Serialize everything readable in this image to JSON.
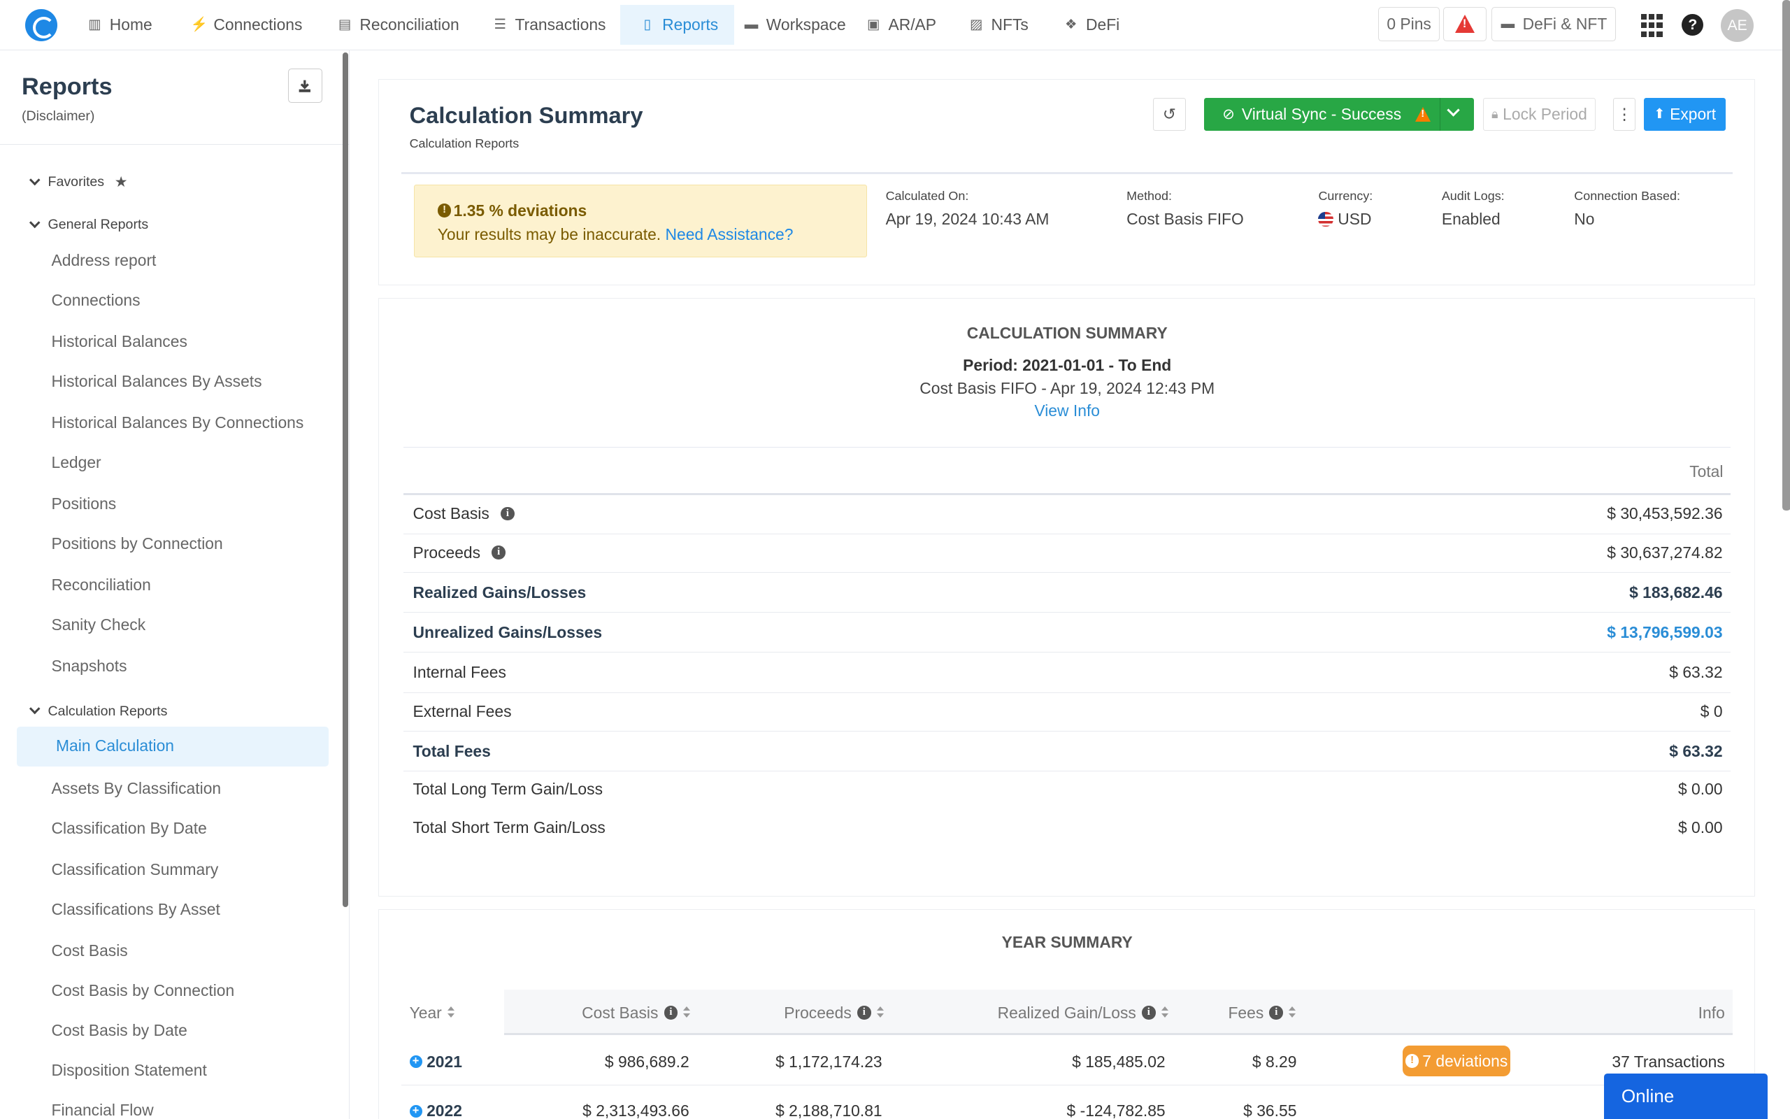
{
  "nav": {
    "items": [
      {
        "label": "Home",
        "icon": "bar-chart-icon"
      },
      {
        "label": "Connections",
        "icon": "plug-icon"
      },
      {
        "label": "Reconciliation",
        "icon": "ledger-icon"
      },
      {
        "label": "Transactions",
        "icon": "list-icon"
      },
      {
        "label": "Reports",
        "icon": "report-icon"
      },
      {
        "label": "Workspace",
        "icon": "briefcase-icon"
      },
      {
        "label": "AR/AP",
        "icon": "money-icon"
      },
      {
        "label": "NFTs",
        "icon": "image-icon"
      },
      {
        "label": "DeFi",
        "icon": "cubes-icon"
      }
    ],
    "active": "Reports",
    "pins_label": "0 Pins",
    "workspace_label": "DeFi & NFT",
    "avatar_initials": "AE"
  },
  "sidebar": {
    "title": "Reports",
    "subtitle": "(Disclaimer)",
    "groups": {
      "favorites": "Favorites",
      "general": "General Reports",
      "calculation": "Calculation Reports"
    },
    "general_items": [
      "Address report",
      "Connections",
      "Historical Balances",
      "Historical Balances By Assets",
      "Historical Balances By Connections",
      "Ledger",
      "Positions",
      "Positions by Connection",
      "Reconciliation",
      "Sanity Check",
      "Snapshots"
    ],
    "active_item": "Main Calculation",
    "calc_items": [
      "Assets By Classification",
      "Classification By Date",
      "Classification Summary",
      "Classifications By Asset",
      "Cost Basis",
      "Cost Basis by Connection",
      "Cost Basis by Date",
      "Disposition Statement",
      "Financial Flow"
    ]
  },
  "header": {
    "title": "Calculation Summary",
    "breadcrumb": "Calculation Reports",
    "sync_label": "Virtual Sync - Success",
    "lock_label": "Lock Period",
    "export_label": "Export"
  },
  "alert": {
    "headline": "1.35 % deviations",
    "text": "Your results may be inaccurate.",
    "link": "Need Assistance?"
  },
  "meta": {
    "calculated_label": "Calculated On:",
    "calculated_value": "Apr 19, 2024 10:43 AM",
    "method_label": "Method:",
    "method_value": "Cost Basis FIFO",
    "currency_label": "Currency:",
    "currency_value": "USD",
    "audit_label": "Audit Logs:",
    "audit_value": "Enabled",
    "connection_label": "Connection Based:",
    "connection_value": "No"
  },
  "summary": {
    "heading": "CALCULATION SUMMARY",
    "period": "Period: 2021-01-01 - To End",
    "method_line": "Cost Basis FIFO - Apr 19, 2024 12:43 PM",
    "view_info": "View Info",
    "total_header": "Total",
    "rows": [
      {
        "label": "Cost Basis",
        "value": "$ 30,453,592.36"
      },
      {
        "label": "Proceeds",
        "value": "$ 30,637,274.82"
      },
      {
        "label": "Realized Gains/Losses",
        "value": "$ 183,682.46"
      },
      {
        "label": "Unrealized Gains/Losses",
        "value": "$ 13,796,599.03"
      },
      {
        "label": "Internal Fees",
        "value": "$ 63.32"
      },
      {
        "label": "External Fees",
        "value": "$ 0"
      },
      {
        "label": "Total Fees",
        "value": "$ 63.32"
      },
      {
        "label": "Total Long Term Gain/Loss",
        "value": "$ 0.00"
      },
      {
        "label": "Total Short Term Gain/Loss",
        "value": "$ 0.00"
      }
    ]
  },
  "year_summary": {
    "heading": "YEAR SUMMARY",
    "columns": [
      "Year",
      "Cost Basis",
      "Proceeds",
      "Realized Gain/Loss",
      "Fees",
      "Info"
    ],
    "rows": [
      {
        "year": "2021",
        "cost_basis": "$ 986,689.2",
        "proceeds": "$ 1,172,174.23",
        "realized": "$ 185,485.02",
        "fees": "$ 8.29",
        "deviations": "7 deviations",
        "info": "37 Transactions"
      },
      {
        "year": "2022",
        "cost_basis": "$ 2,313,493.66",
        "proceeds": "$ 2,188,710.81",
        "realized": "$ -124,782.85",
        "fees": "$ 36.55",
        "deviations": "",
        "info": ""
      }
    ]
  },
  "chat": {
    "label": "Online"
  },
  "colors": {
    "accent": "#2196f3",
    "success": "#28a745",
    "warning": "#f39c33",
    "alert_bg": "#fdf2cf"
  }
}
